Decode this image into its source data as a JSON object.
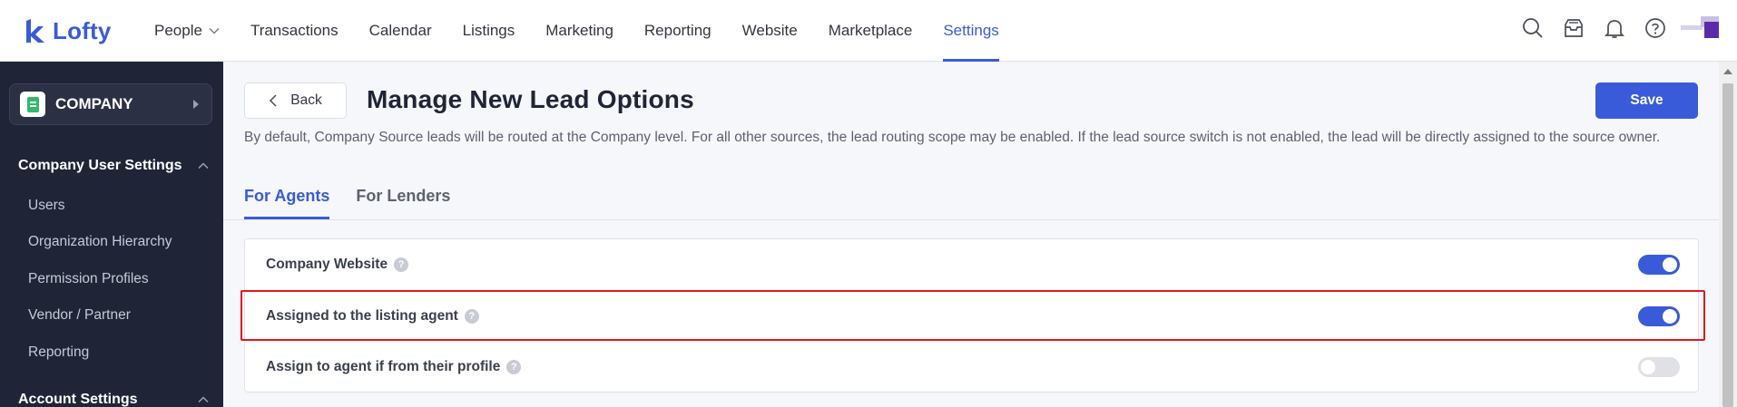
{
  "app": {
    "logo_text": "Lofty"
  },
  "nav": {
    "items": [
      {
        "label": "People",
        "has_dropdown": true
      },
      {
        "label": "Transactions"
      },
      {
        "label": "Calendar"
      },
      {
        "label": "Listings"
      },
      {
        "label": "Marketing"
      },
      {
        "label": "Reporting"
      },
      {
        "label": "Website"
      },
      {
        "label": "Marketplace"
      },
      {
        "label": "Settings",
        "active": true
      }
    ]
  },
  "top_icons": [
    "search-icon",
    "inbox-icon",
    "bell-icon",
    "help-icon"
  ],
  "sidebar": {
    "company_label": "COMPANY",
    "section1": {
      "title": "Company User Settings",
      "items": [
        "Users",
        "Organization Hierarchy",
        "Permission Profiles",
        "Vendor / Partner",
        "Reporting"
      ]
    },
    "section2": {
      "title": "Account Settings"
    }
  },
  "main": {
    "back_label": "Back",
    "title": "Manage New Lead Options",
    "save_label": "Save",
    "description": "By default, Company Source leads will be routed at the Company level. For all other sources, the lead routing scope may be enabled. If the lead source switch is not enabled, the lead will be directly assigned to the source owner.",
    "tabs": [
      {
        "label": "For Agents",
        "active": true
      },
      {
        "label": "For Lenders"
      }
    ],
    "options": [
      {
        "label": "Company Website",
        "enabled": true
      },
      {
        "label": "Assigned to the listing agent",
        "enabled": true,
        "highlighted": true
      },
      {
        "label": "Assign to agent if from their profile",
        "enabled": false
      }
    ],
    "help_glyph": "?"
  },
  "colors": {
    "accent": "#3a5bd9",
    "sidebar_bg": "#202437",
    "highlight": "#e2161d"
  }
}
